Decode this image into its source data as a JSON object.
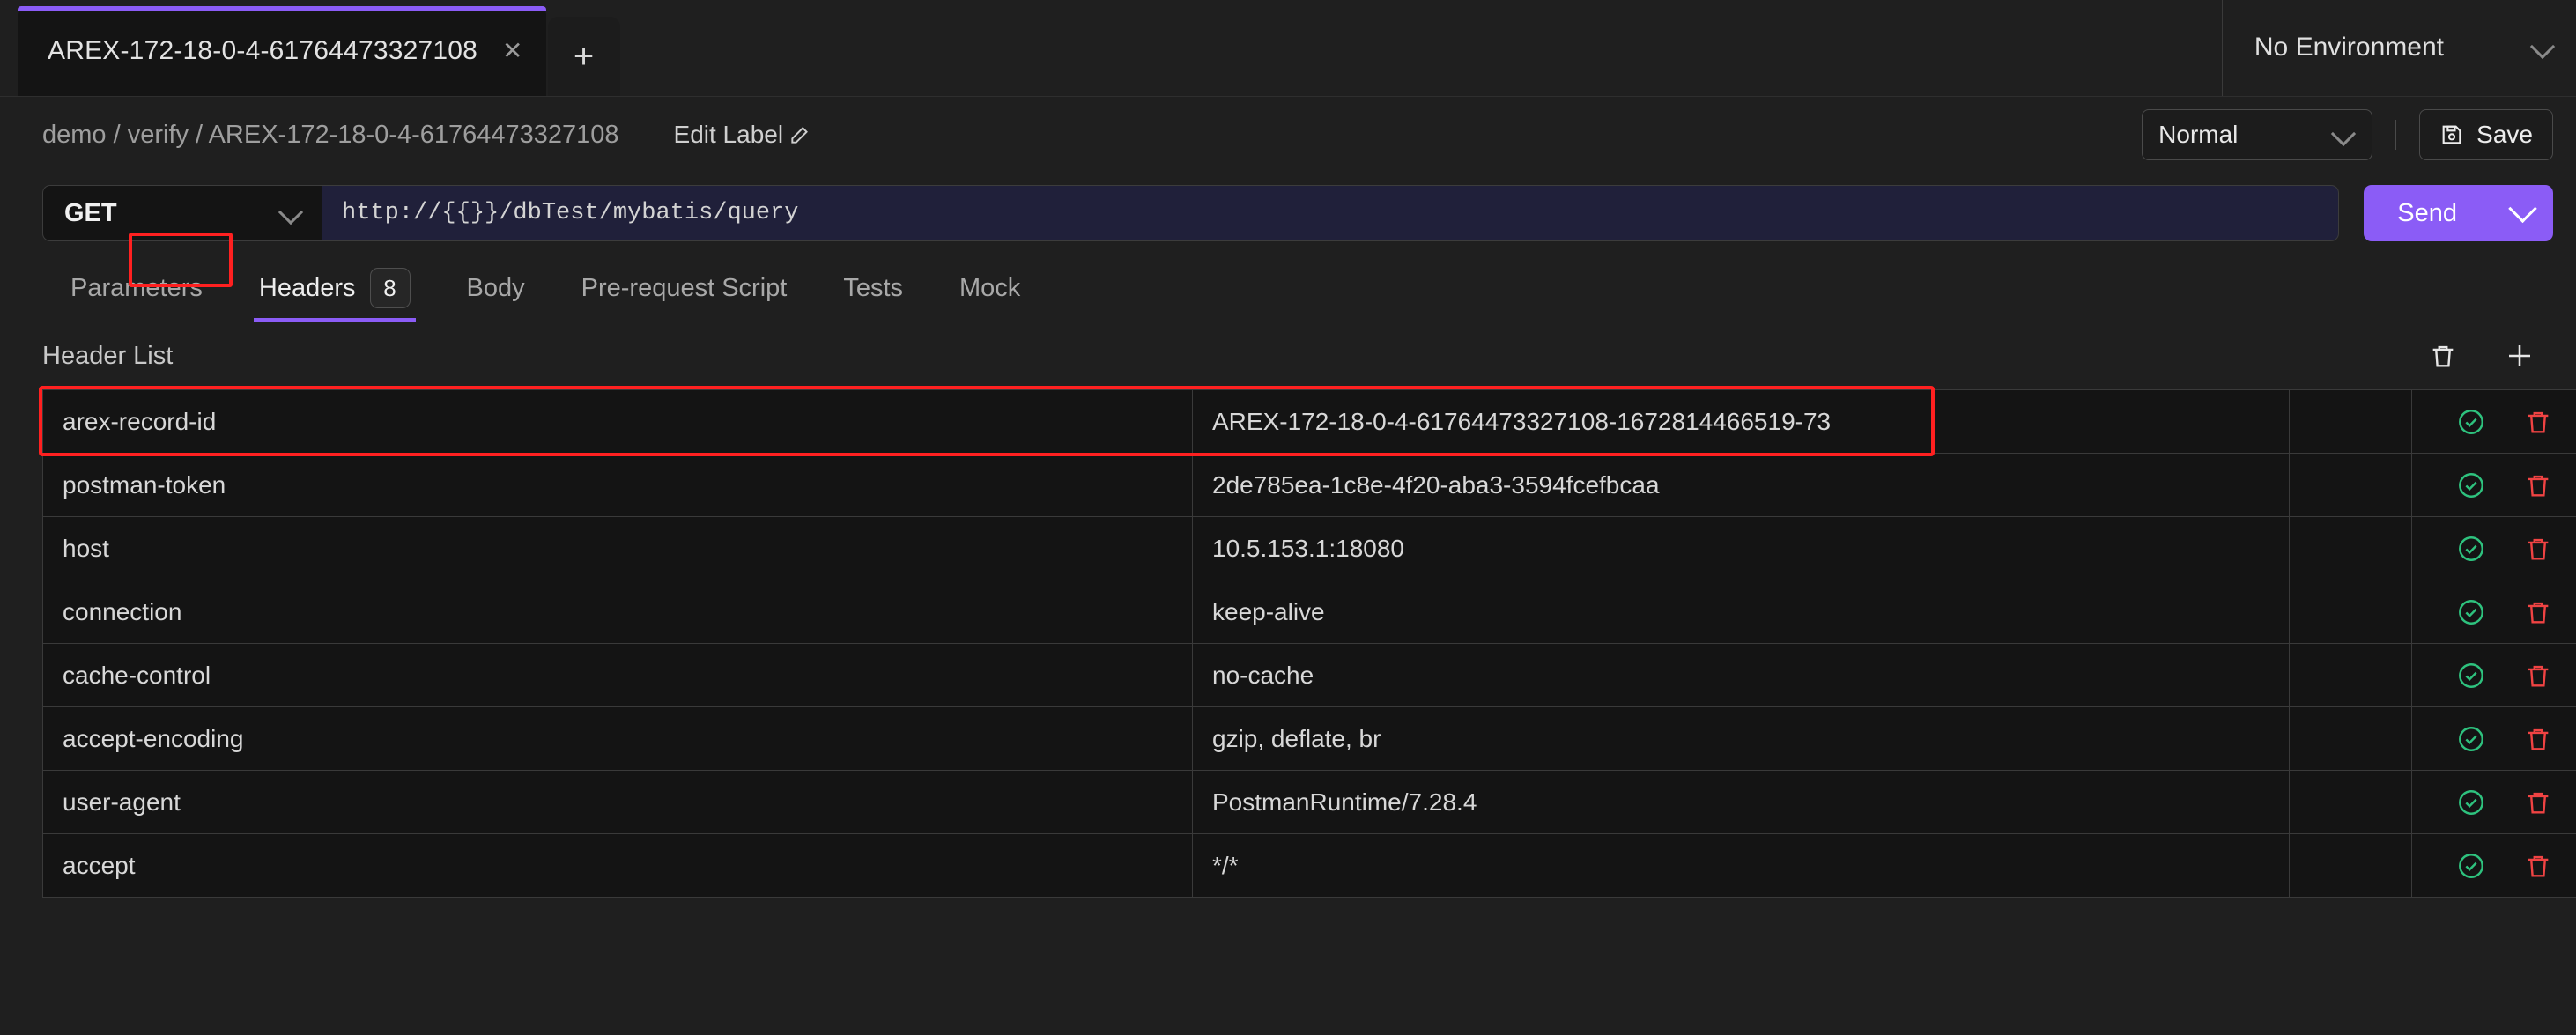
{
  "window": {
    "tabs": [
      {
        "label": "AREX-172-18-0-4-61764473327108",
        "close_icon": "close-icon",
        "active": true
      }
    ],
    "new_tab_icon": "plus-icon",
    "environment": {
      "label": "No Environment",
      "caret_icon": "chevron-down-icon"
    }
  },
  "breadcrumb": {
    "text": "demo / verify / AREX-172-18-0-4-61764473327108",
    "edit_label": "Edit Label",
    "edit_icon": "pencil-icon"
  },
  "toolbar": {
    "mode": {
      "value": "Normal",
      "caret_icon": "chevron-down-icon"
    },
    "save_label": "Save",
    "save_icon": "floppy-disk-icon"
  },
  "request": {
    "method": "GET",
    "method_caret_icon": "chevron-down-icon",
    "url": "http://{{}}/dbTest/mybatis/query",
    "send_label": "Send",
    "send_caret_icon": "chevron-down-icon"
  },
  "section_tabs": [
    {
      "label": "Parameters",
      "badge": null,
      "active": false
    },
    {
      "label": "Headers",
      "badge": "8",
      "active": true
    },
    {
      "label": "Body",
      "badge": null,
      "active": false
    },
    {
      "label": "Pre-request Script",
      "badge": null,
      "active": false
    },
    {
      "label": "Tests",
      "badge": null,
      "active": false
    },
    {
      "label": "Mock",
      "badge": null,
      "active": false
    }
  ],
  "header_list": {
    "title": "Header List",
    "delete_all_icon": "trash-icon",
    "add_icon": "plus-icon",
    "row_check_icon": "check-circle-icon",
    "row_delete_icon": "trash-icon",
    "rows": [
      {
        "key": "arex-record-id",
        "value": "AREX-172-18-0-4-61764473327108-1672814466519-73",
        "highlighted": true
      },
      {
        "key": "postman-token",
        "value": "2de785ea-1c8e-4f20-aba3-3594fcefbcaa",
        "highlighted": false
      },
      {
        "key": "host",
        "value": "10.5.153.1:18080",
        "highlighted": false
      },
      {
        "key": "connection",
        "value": "keep-alive",
        "highlighted": false
      },
      {
        "key": "cache-control",
        "value": "no-cache",
        "highlighted": false
      },
      {
        "key": "accept-encoding",
        "value": "gzip, deflate, br",
        "highlighted": false
      },
      {
        "key": "user-agent",
        "value": "PostmanRuntime/7.28.4",
        "highlighted": false
      },
      {
        "key": "accept",
        "value": "*/*",
        "highlighted": false
      }
    ]
  },
  "colors": {
    "accent": "#8b5cf6",
    "annotation": "#ff2020",
    "success": "#2ec27e",
    "danger": "#f04343",
    "page_bg": "#1f1f1f",
    "cell_bg": "#141414"
  }
}
